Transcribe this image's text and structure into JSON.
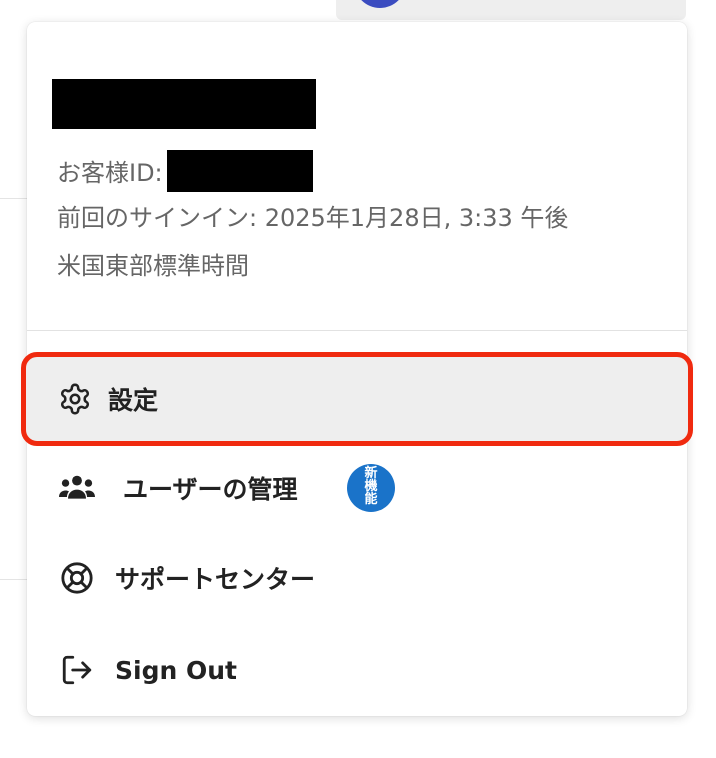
{
  "account": {
    "customer_id_label": "お客様ID:",
    "last_signin": "前回のサインイン: 2025年1月28日, 3:33 午後",
    "timezone": "米国東部標準時間"
  },
  "menu": {
    "settings_label": "設定",
    "users_label": "ユーザーの管理",
    "users_badge": "新\n機\n能",
    "support_label": "サポートセンター",
    "signout_label": "Sign Out"
  },
  "icons": {
    "settings": "gear-icon",
    "users": "users-icon",
    "support": "lifebuoy-icon",
    "signout": "sign-out-icon"
  },
  "colors": {
    "highlight_border": "#f02a0f",
    "highlight_bg": "#eeeeee",
    "badge": "#1a73c9",
    "avatar": "#3b4cc0"
  }
}
